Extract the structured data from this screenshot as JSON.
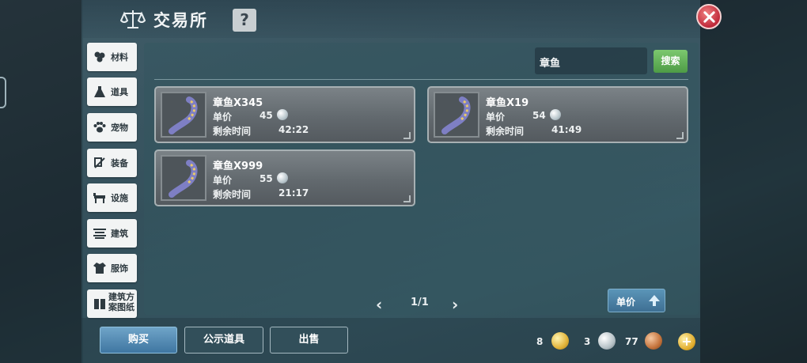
{
  "header": {
    "title": "交易所",
    "help": "?"
  },
  "categories": [
    {
      "label": "材料",
      "icon": "materials-icon"
    },
    {
      "label": "道具",
      "icon": "potion-icon"
    },
    {
      "label": "宠物",
      "icon": "paw-icon"
    },
    {
      "label": "装备",
      "icon": "equipment-icon"
    },
    {
      "label": "设施",
      "icon": "facility-icon"
    },
    {
      "label": "建筑",
      "icon": "building-icon"
    },
    {
      "label": "服饰",
      "icon": "clothing-icon"
    },
    {
      "label": "建筑方案图纸",
      "icon": "blueprint-icon"
    }
  ],
  "search": {
    "value": "章鱼",
    "button": "搜索"
  },
  "listings": [
    {
      "name": "章鱼X345",
      "price_label": "单价",
      "price": "45",
      "time_label": "剩余时间",
      "time": "42:22"
    },
    {
      "name": "章鱼X19",
      "price_label": "单价",
      "price": "54",
      "time_label": "剩余时间",
      "time": "41:49"
    },
    {
      "name": "章鱼X999",
      "price_label": "单价",
      "price": "55",
      "time_label": "剩余时间",
      "time": "21:17"
    }
  ],
  "pager": {
    "prev": "‹",
    "text": "1/1",
    "next": "›"
  },
  "sort": {
    "label": "单价",
    "icon": "sort-up-icon"
  },
  "bottom": {
    "buy": "购买",
    "public": "公示道具",
    "sell": "出售"
  },
  "currency": {
    "gold": "8",
    "silver": "3",
    "bronze": "77"
  },
  "colors": {
    "search_button": "#5fae55",
    "close_button": "#d0394a",
    "primary_button": "#4f86b0"
  }
}
